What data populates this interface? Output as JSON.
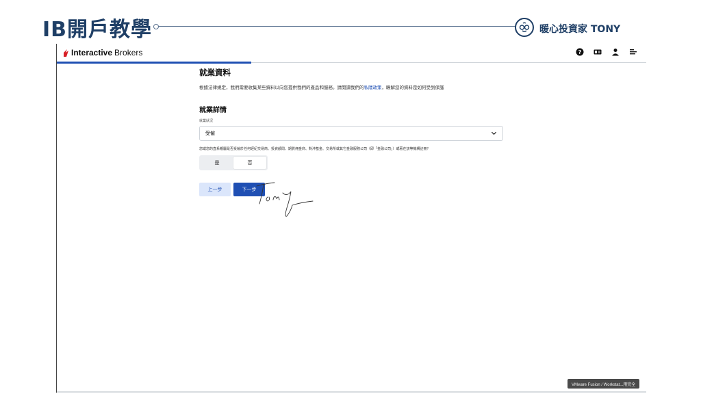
{
  "slide": {
    "title": "IB開戶教學",
    "brand": "暖心投資家 TONY"
  },
  "app": {
    "logo_bold": "Interactive",
    "logo_light": "Brokers",
    "icons": [
      "help-icon",
      "id-card-icon",
      "user-icon",
      "menu-icon"
    ]
  },
  "page": {
    "title": "就業資料",
    "intro_before": "根據法律規定，我們需要收集某些資料以向您提供我們的產品和服務。請閱讀我們的",
    "intro_link": "私隱政策",
    "intro_after": "，瞭解您的資料是如何受到保護",
    "section_title": "就業詳情",
    "field_label": "就業狀況",
    "employment_status": "受僱",
    "question": "您或您的直系親屬是否受僱於任何經紀交易商、投資顧問、期貨佣金商、對沖基金、交易所或其它金融服務公司（即「金融公司」）或著在該等機構註冊？",
    "option_yes": "是",
    "option_no": "否",
    "selected_option": "否",
    "prev_button": "上一步",
    "next_button": "下一步"
  },
  "tooltip": "VMware Fusion / Workstat...用完全",
  "colors": {
    "accent": "#1f4fb3",
    "slide_title": "#1f3f66",
    "ib_red": "#d81f26"
  }
}
